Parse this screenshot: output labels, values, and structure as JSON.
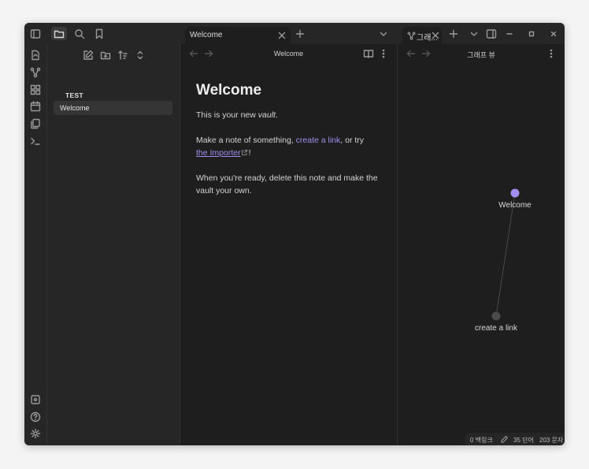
{
  "titlebar": {
    "tabs": [
      {
        "label": "Welcome"
      },
      {
        "label": "그래..."
      }
    ]
  },
  "sidebar": {
    "vault_name": "TEST",
    "files": [
      "Welcome"
    ]
  },
  "editor": {
    "view_title": "Welcome",
    "heading": "Welcome",
    "para1_pre": "This is your new ",
    "para1_em": "vault",
    "para1_post": ".",
    "para2_pre": "Make a note of something, ",
    "para2_link": "create a link",
    "para2_mid": ", or try",
    "para2_ext_link": "the Importer",
    "para2_post": "!",
    "para3": "When you're ready, delete this note and make the vault your own."
  },
  "graph": {
    "view_title": "그래프 뷰",
    "nodes": [
      {
        "label": "Welcome",
        "color": "#a28ef0"
      },
      {
        "label": "create a link",
        "color": "#4a4a4a"
      }
    ]
  },
  "status": {
    "backlinks": "0 백링크",
    "words": "35 단어",
    "chars": "203 문자"
  },
  "colors": {
    "accent": "#a28ef0",
    "background": "#1e1e1e",
    "panel": "#262626"
  }
}
